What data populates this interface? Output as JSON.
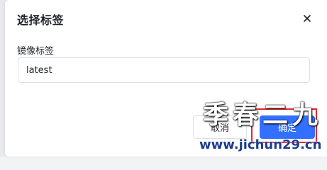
{
  "dialog": {
    "title": "选择标签",
    "close_icon": "close-icon",
    "field_label": "镜像标签",
    "input_value": "latest",
    "cancel_label": "取消",
    "ok_label": "确定"
  },
  "watermark": {
    "text": "季春二九",
    "url": "www.jichun29.cn"
  },
  "colors": {
    "primary": "#3370ff",
    "highlight": "#e8262a"
  }
}
